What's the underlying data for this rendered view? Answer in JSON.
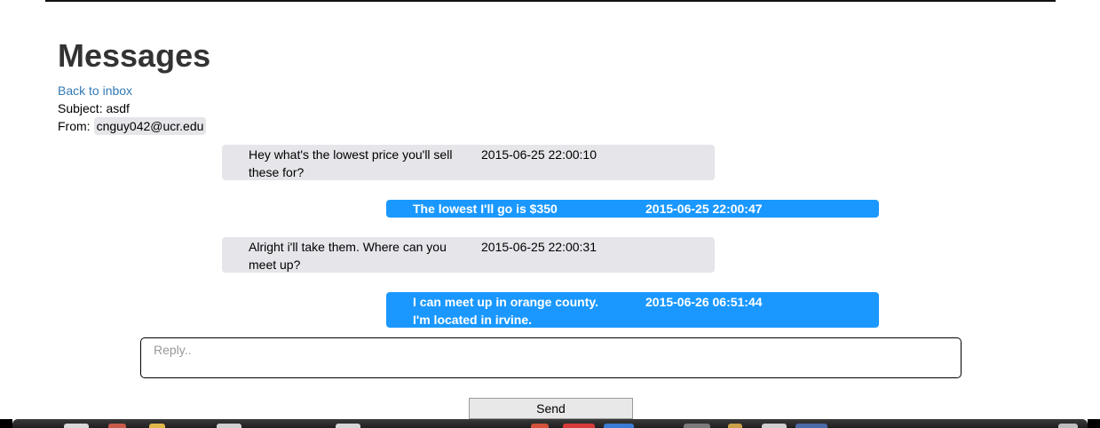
{
  "page": {
    "title": "Messages",
    "back_link": "Back to inbox",
    "subject": "Subject: asdf",
    "from_label": "From:",
    "from_email": "cnguy042@ucr.edu"
  },
  "messages": [
    {
      "direction": "received",
      "text": "Hey what's the lowest price you'll sell these for?",
      "time": "2015-06-25 22:00:10"
    },
    {
      "direction": "sent",
      "text": "The lowest I'll go is $350",
      "time": "2015-06-25 22:00:47"
    },
    {
      "direction": "received",
      "text": "Alright i'll take them. Where can you meet up?",
      "time": "2015-06-25 22:00:31"
    },
    {
      "direction": "sent",
      "text": "I can meet up in orange county. I'm located in irvine.",
      "time": "2015-06-26 06:51:44"
    }
  ],
  "reply": {
    "value": "",
    "placeholder": "Reply.."
  },
  "send_label": "Send",
  "colors": {
    "received_bubble": "#e5e5ea",
    "sent_bubble": "#1a98ff",
    "link": "#337ab7"
  }
}
